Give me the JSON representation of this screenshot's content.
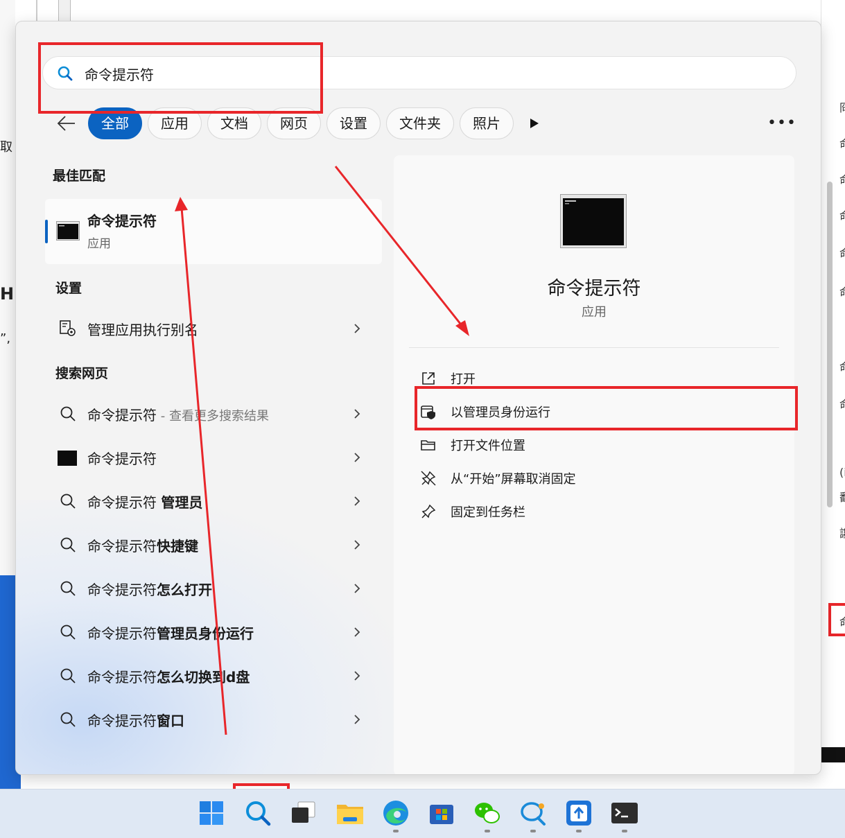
{
  "background": {
    "left_fragments": [
      "取",
      "H",
      "”,"
    ],
    "right_fragments": [
      "冏",
      "命",
      "命",
      "命",
      "命",
      "命",
      "命",
      "命",
      "(i",
      "鄱",
      "讒",
      "命"
    ]
  },
  "search": {
    "value": "命令提示符",
    "icon": "search-icon"
  },
  "filters": {
    "back_icon": "arrow-left-icon",
    "chips": [
      "全部",
      "应用",
      "文档",
      "网页",
      "设置",
      "文件夹",
      "照片"
    ],
    "active_index": 0,
    "play_icon": "play-icon",
    "more_label": "•••"
  },
  "best_match": {
    "section_title": "最佳匹配",
    "name": "命令提示符",
    "type": "应用",
    "icon": "cmd-icon"
  },
  "settings": {
    "section_title": "设置",
    "items": [
      {
        "label": "管理应用执行别名",
        "icon": "app-alias-icon"
      }
    ]
  },
  "web": {
    "section_title": "搜索网页",
    "items": [
      {
        "prefix": "命令提示符",
        "bold": "",
        "sub": " - 查看更多搜索结果",
        "icon": "search-icon"
      },
      {
        "prefix": "命令提示符",
        "bold": "",
        "sub": "",
        "icon": "cmd-thumbnail-icon"
      },
      {
        "prefix": "命令提示符 ",
        "bold": "管理员",
        "sub": "",
        "icon": "search-icon"
      },
      {
        "prefix": "命令提示符",
        "bold": "快捷键",
        "sub": "",
        "icon": "search-icon"
      },
      {
        "prefix": "命令提示符",
        "bold": "怎么打开",
        "sub": "",
        "icon": "search-icon"
      },
      {
        "prefix": "命令提示符",
        "bold": "管理员身份运行",
        "sub": "",
        "icon": "search-icon"
      },
      {
        "prefix": "命令提示符",
        "bold": "怎么切换到d盘",
        "sub": "",
        "icon": "search-icon"
      },
      {
        "prefix": "命令提示符",
        "bold": "窗口",
        "sub": "",
        "icon": "search-icon"
      }
    ]
  },
  "detail": {
    "title": "命令提示符",
    "type": "应用",
    "actions": [
      {
        "label": "打开",
        "icon": "open-external-icon"
      },
      {
        "label": "以管理员身份运行",
        "icon": "run-as-admin-icon"
      },
      {
        "label": "打开文件位置",
        "icon": "folder-icon"
      },
      {
        "label": "从“开始”屏幕取消固定",
        "icon": "unpin-icon"
      },
      {
        "label": "固定到任务栏",
        "icon": "pin-icon"
      }
    ]
  },
  "taskbar": {
    "items": [
      "windows-start-icon",
      "search-icon",
      "task-view-icon",
      "file-explorer-icon",
      "edge-icon",
      "store-icon",
      "wechat-icon",
      "chat-search-icon",
      "upload-app-icon",
      "terminal-icon"
    ]
  },
  "colors": {
    "accent": "#0b63c1",
    "annotation_red": "#e8262a",
    "taskbar": "#dfe8f4",
    "panel": "#f3f3f3"
  }
}
